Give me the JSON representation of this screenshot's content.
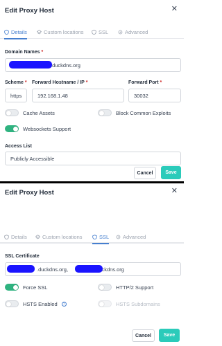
{
  "dialog1": {
    "title": "Edit Proxy Host",
    "tabs": [
      {
        "label": "Details",
        "icon": "shield-icon",
        "active": true
      },
      {
        "label": "Custom locations",
        "icon": "layers-icon",
        "active": false
      },
      {
        "label": "SSL",
        "icon": "shield-icon",
        "active": false
      },
      {
        "label": "Advanced",
        "icon": "settings-icon",
        "active": false
      }
    ],
    "domain_names": {
      "label": "Domain Names",
      "value": ".duckdns.org"
    },
    "scheme": {
      "label": "Scheme",
      "value": "https"
    },
    "forward_host": {
      "label": "Forward Hostname / IP",
      "value": "192.168.1.48"
    },
    "forward_port": {
      "label": "Forward Port",
      "value": "30032"
    },
    "cache_assets": {
      "label": "Cache Assets",
      "on": false
    },
    "block_exploits": {
      "label": "Block Common Exploits",
      "on": false
    },
    "websockets": {
      "label": "Websockets Support",
      "on": true
    },
    "access_list": {
      "label": "Access List",
      "value": "Publicly Accessible"
    },
    "cancel_label": "Cancel",
    "save_label": "Save"
  },
  "dialog2": {
    "title": "Edit Proxy Host",
    "tabs": [
      {
        "label": "Details",
        "icon": "shield-icon",
        "active": false
      },
      {
        "label": "Custom locations",
        "icon": "layers-icon",
        "active": false
      },
      {
        "label": "SSL",
        "icon": "shield-icon",
        "active": true
      },
      {
        "label": "Advanced",
        "icon": "settings-icon",
        "active": false
      }
    ],
    "ssl_certificate": {
      "label": "SSL Certificate",
      "value_part1": ".duckdns.org,",
      "value_part2": ".duckdns.org"
    },
    "force_ssl": {
      "label": "Force SSL",
      "on": true
    },
    "http2": {
      "label": "HTTP/2 Support",
      "on": false
    },
    "hsts": {
      "label": "HSTS Enabled",
      "on": false,
      "help_icon": "question-icon",
      "help_glyph": "?"
    },
    "hsts_sub": {
      "label": "HSTS Subdomains",
      "on": false,
      "disabled": true
    },
    "cancel_label": "Cancel",
    "save_label": "Save"
  },
  "colors": {
    "accent": "#467fcf",
    "toggle_on": "#2fb380",
    "save": "#2bcbba",
    "required": "#cd201f",
    "redaction": "#1a14ff"
  }
}
